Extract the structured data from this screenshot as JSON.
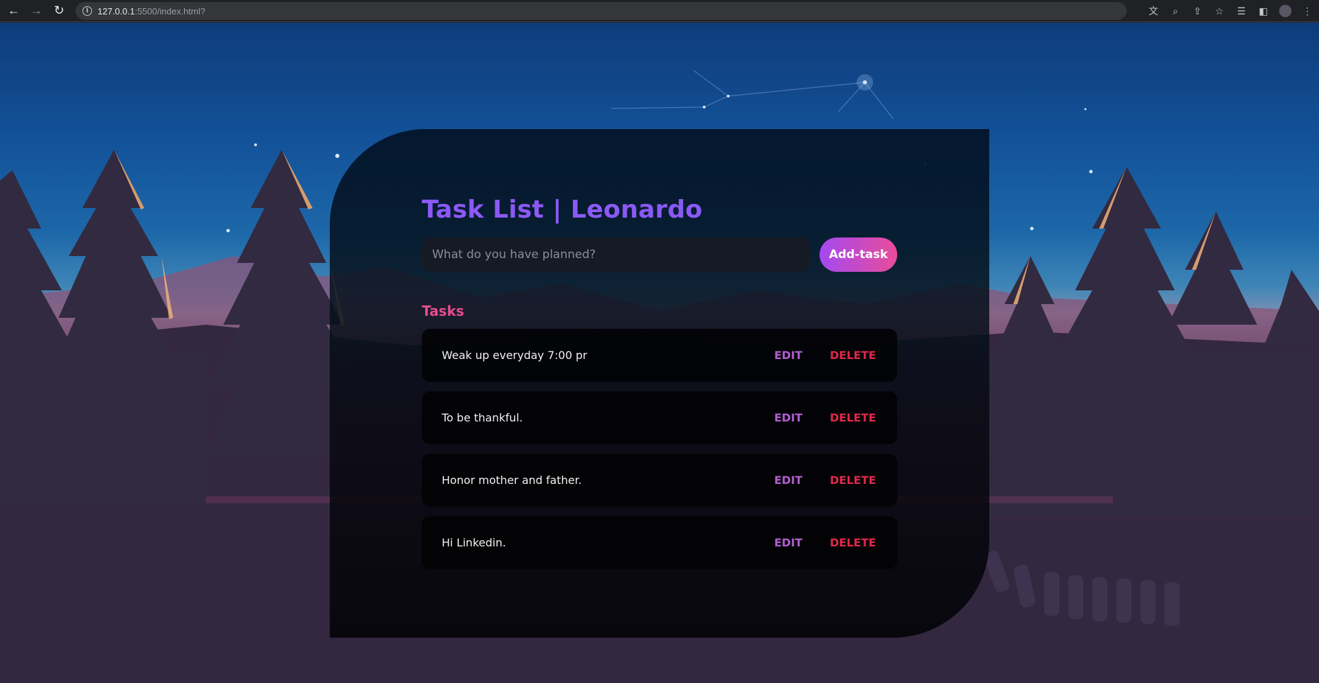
{
  "browser": {
    "url_host": "127.0.0.1",
    "url_path": ":5500/index.html?"
  },
  "app": {
    "title": "Task List | Leonardo",
    "input_placeholder": "What do you have planned?",
    "add_button": "Add-task",
    "section_label": "Tasks",
    "edit_label": "EDIT",
    "delete_label": "DELETE",
    "tasks": [
      {
        "text": "Weak up everyday 7:00 pr"
      },
      {
        "text": "To be thankful."
      },
      {
        "text": "Honor mother and father."
      },
      {
        "text": "Hi Linkedin."
      }
    ]
  },
  "colors": {
    "title": "#8b59f5",
    "section_label": "#e84c8e",
    "edit": "#b05fd0",
    "delete": "#e0294a",
    "add_gradient_start": "#a449f0",
    "add_gradient_end": "#e94c9a"
  }
}
